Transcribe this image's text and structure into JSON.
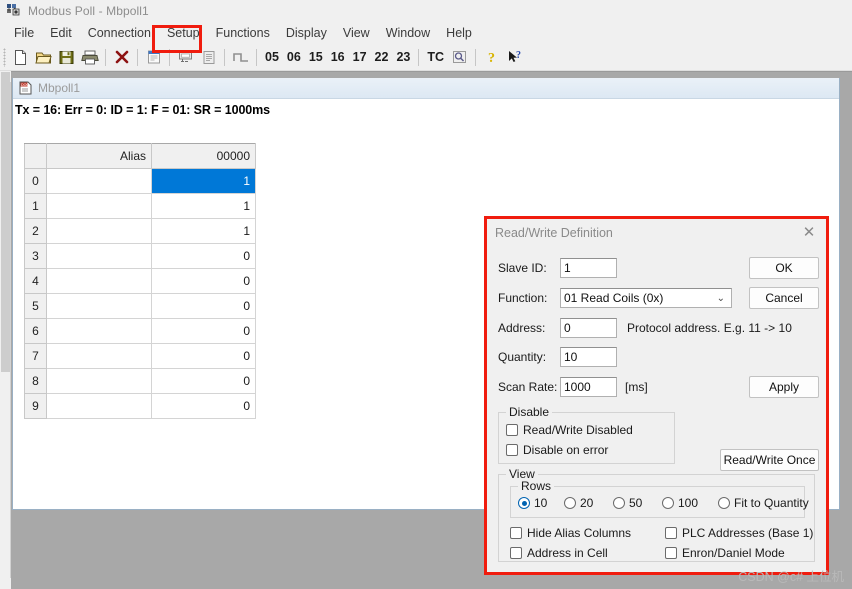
{
  "window": {
    "title": "Modbus Poll - Mbpoll1",
    "icon": "modbus-app-icon"
  },
  "menubar": {
    "items": [
      {
        "label": "File"
      },
      {
        "label": "Edit"
      },
      {
        "label": "Connection"
      },
      {
        "label": "Setup",
        "highlighted": true
      },
      {
        "label": "Functions"
      },
      {
        "label": "Display"
      },
      {
        "label": "View"
      },
      {
        "label": "Window"
      },
      {
        "label": "Help"
      }
    ],
    "highlight_color": "#f01c0e"
  },
  "toolbar": {
    "icons": [
      {
        "name": "new-file-icon"
      },
      {
        "name": "open-folder-icon"
      },
      {
        "name": "save-disk-icon"
      },
      {
        "name": "print-icon"
      },
      {
        "name": "delete-x-icon"
      },
      {
        "name": "window-panel-icon"
      },
      {
        "name": "read-write-icon"
      },
      {
        "name": "clipboard-icon"
      },
      {
        "name": "pulse-signal-icon"
      }
    ],
    "function_codes": [
      "05",
      "06",
      "15",
      "16",
      "17",
      "22",
      "23"
    ],
    "tc_label": "TC",
    "trailing_icons": [
      {
        "name": "tc-window-icon"
      },
      {
        "name": "help-question-icon"
      },
      {
        "name": "context-help-arrow-icon"
      }
    ]
  },
  "child_window": {
    "title": "Mbpoll1",
    "icon": "document-icon",
    "status_line": "Tx = 16: Err = 0: ID = 1: F = 01: SR = 1000ms"
  },
  "grid": {
    "headers": {
      "corner": "",
      "alias": "Alias",
      "value": "00000"
    },
    "selected_row": 0,
    "selection_color": "#0078d7",
    "rows": [
      {
        "index": "0",
        "alias": "",
        "value": "1"
      },
      {
        "index": "1",
        "alias": "",
        "value": "1"
      },
      {
        "index": "2",
        "alias": "",
        "value": "1"
      },
      {
        "index": "3",
        "alias": "",
        "value": "0"
      },
      {
        "index": "4",
        "alias": "",
        "value": "0"
      },
      {
        "index": "5",
        "alias": "",
        "value": "0"
      },
      {
        "index": "6",
        "alias": "",
        "value": "0"
      },
      {
        "index": "7",
        "alias": "",
        "value": "0"
      },
      {
        "index": "8",
        "alias": "",
        "value": "0"
      },
      {
        "index": "9",
        "alias": "",
        "value": "0"
      }
    ]
  },
  "dialog": {
    "title": "Read/Write Definition",
    "close_icon": "close-icon",
    "border_color": "#f01c0e",
    "fields": {
      "slave_id": {
        "label": "Slave ID:",
        "value": "1"
      },
      "function": {
        "label": "Function:",
        "value": "01 Read Coils (0x)",
        "chevron": "chevron-down-icon"
      },
      "address": {
        "label": "Address:",
        "value": "0",
        "hint": "Protocol address. E.g. 11 -> 10"
      },
      "quantity": {
        "label": "Quantity:",
        "value": "10"
      },
      "scan_rate": {
        "label": "Scan Rate:",
        "value": "1000",
        "unit": "[ms]"
      }
    },
    "buttons": {
      "ok": "OK",
      "cancel": "Cancel",
      "apply": "Apply",
      "read_write_once": "Read/Write Once"
    },
    "disable_group": {
      "legend": "Disable",
      "items": [
        {
          "label": "Read/Write Disabled",
          "checked": false
        },
        {
          "label": "Disable on error",
          "checked": false
        }
      ]
    },
    "view_group": {
      "legend": "View",
      "rows_group": {
        "legend": "Rows",
        "options": [
          {
            "label": "10",
            "selected": true
          },
          {
            "label": "20",
            "selected": false
          },
          {
            "label": "50",
            "selected": false
          },
          {
            "label": "100",
            "selected": false
          },
          {
            "label": "Fit to Quantity",
            "selected": false
          }
        ]
      },
      "checkboxes": [
        {
          "label": "Hide Alias Columns",
          "checked": false
        },
        {
          "label": "PLC Addresses (Base 1)",
          "checked": false
        },
        {
          "label": "Address in Cell",
          "checked": false
        },
        {
          "label": "Enron/Daniel Mode",
          "checked": false
        }
      ]
    }
  },
  "watermark": {
    "text": "CSDN @c# 上位机"
  }
}
